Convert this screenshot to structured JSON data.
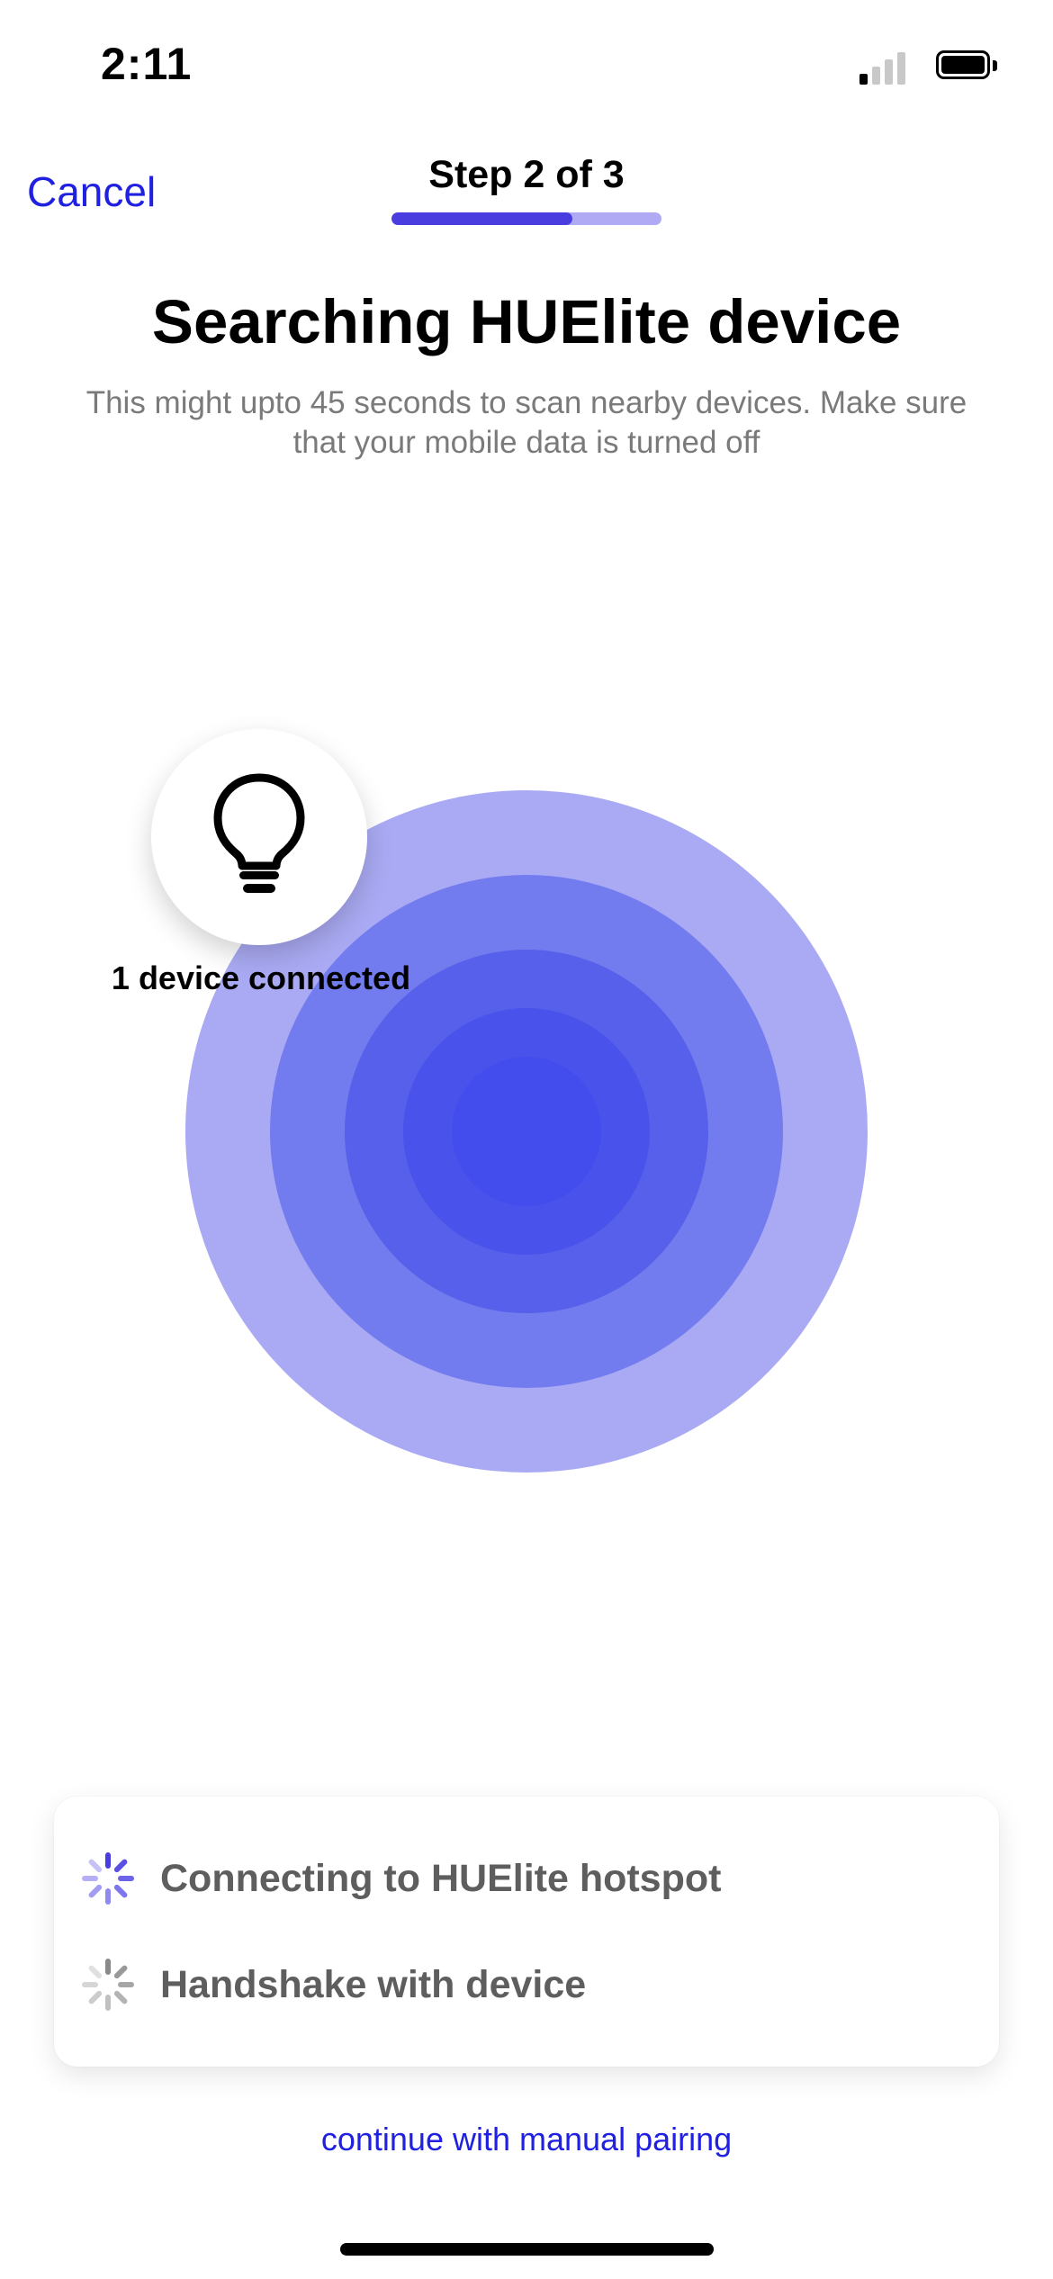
{
  "status_bar": {
    "time": "2:11",
    "signal_bars_active": 1,
    "signal_bars_total": 4,
    "battery_level": 0.85
  },
  "header": {
    "cancel_label": "Cancel",
    "step_label": "Step 2 of 3",
    "step_progress": 0.67
  },
  "main": {
    "title": "Searching HUElite device",
    "subtitle": "This might upto 45 seconds to scan nearby devices. Make sure that your mobile data is turned off",
    "device_icon": "lightbulb-icon",
    "device_status": "1 device connected"
  },
  "colors": {
    "accent": "#2020e0",
    "progress": "#4a3de0",
    "ring_outer": "#aaaaf4",
    "ring_inner": "#4349ec"
  },
  "status_list": [
    {
      "label": "Connecting to HUElite hotspot",
      "icon": "spinner-icon",
      "state": "active"
    },
    {
      "label": "Handshake with device",
      "icon": "spinner-icon",
      "state": "pending"
    }
  ],
  "footer": {
    "manual_link": "continue with manual pairing"
  }
}
